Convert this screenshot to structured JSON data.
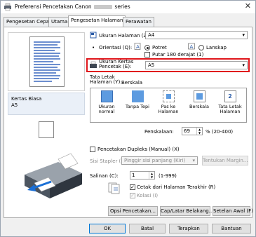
{
  "window": {
    "title_before": "Preferensi Pencetakan Canon",
    "title_after": "series",
    "close": "✕"
  },
  "tabs": [
    "Pengesetan Cepat",
    "Utama",
    "Pengesetan Halaman",
    "Perawatan"
  ],
  "preview_info": {
    "line1": "Kertas Biasa",
    "line2": "A5"
  },
  "page_size": {
    "label": "Ukuran Halaman (Z):",
    "value": "A4"
  },
  "orientation": {
    "label": "Orientasi (Q):",
    "portrait": "Potret",
    "landscape": "Lanskap",
    "rotate180": "Putar 180 derajat (1)"
  },
  "printer_paper": {
    "label_line1": "Ukuran Kertas",
    "label_line2": "Pencetak (E):",
    "value": "A5"
  },
  "page_layout": {
    "label_line1": "Tata Letak",
    "label_line2": "Halaman (Y):",
    "current": "Berskala",
    "options": [
      "Ukuran normal",
      "Tanpa Tepi",
      "Pas ke Halaman",
      "Berskala",
      "Tata Letak Halaman"
    ]
  },
  "scaling": {
    "label": "Penskalaan:",
    "value": "69",
    "range": "% (20-400)"
  },
  "duplex": {
    "label": "Pencetakan Dupleks (Manual) (X)"
  },
  "stapling": {
    "label": "Sisi Stapler (L):",
    "value": "Pinggir sisi panjang (Kiri)",
    "margin_button": "Tentukan Margin..."
  },
  "copies": {
    "label": "Salinan (C):",
    "value": "1",
    "range": "(1-999)",
    "last_page": "Cetak dari Halaman Terakhir (R)",
    "collate": "Kolasi (I)"
  },
  "buttons": {
    "options": "Opsi Pencetakan...",
    "stamp": "Cap/Latar Belakang...",
    "defaults": "Setelan Awal (F)"
  },
  "footer": {
    "ok": "OK",
    "cancel": "Batal",
    "apply": "Terapkan",
    "help": "Bantuan"
  },
  "colors": {
    "highlight": "#e0161b",
    "accent": "#0078d7"
  }
}
